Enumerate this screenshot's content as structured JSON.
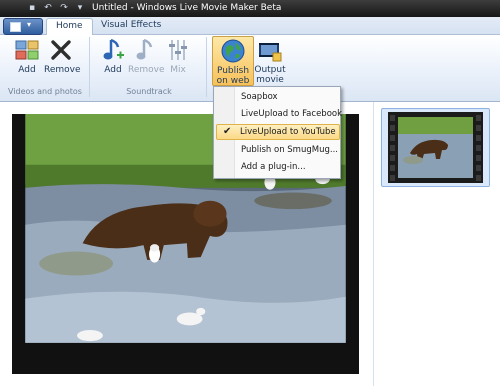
{
  "window": {
    "title": "Untitled - Windows Live Movie Maker Beta"
  },
  "tabs": [
    {
      "label": "Home",
      "active": true
    },
    {
      "label": "Visual Effects",
      "active": false
    }
  ],
  "ribbon": {
    "videos_photos": {
      "group_label": "Videos and photos",
      "add_label": "Add",
      "remove_label": "Remove"
    },
    "soundtrack": {
      "group_label": "Soundtrack",
      "add_label": "Add",
      "remove_label": "Remove",
      "mix_label": "Mix"
    },
    "publish": {
      "publish_line1": "Publish",
      "publish_line2": "on web",
      "output_line1": "Output",
      "output_line2": "movie"
    }
  },
  "publish_menu": {
    "items": [
      {
        "label": "Soapbox",
        "checked": false
      },
      {
        "label": "LiveUpload to Facebook",
        "checked": false
      },
      {
        "label": "LiveUpload to YouTube",
        "checked": true
      },
      {
        "label": "Publish on SmugMug...",
        "checked": false
      },
      {
        "label": "Add a plug-in...",
        "checked": false
      }
    ]
  },
  "colors": {
    "accent": "#2f5d9d",
    "highlight": "#fbd986"
  }
}
